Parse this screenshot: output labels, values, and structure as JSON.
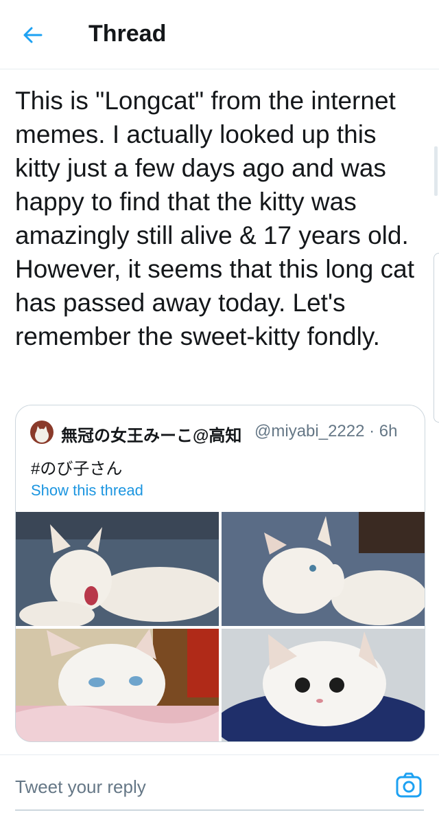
{
  "header": {
    "title": "Thread",
    "back_icon": "arrow-left-icon"
  },
  "tweet": {
    "text": "This is \"Longcat\" from the internet memes. I actually looked up this kitty just a few days ago and was happy to find that the kitty was amazingly still alive & 17 years old. However, it seems that this long cat has passed away today. Let's remember the sweet-kitty fondly."
  },
  "quoted_tweet": {
    "display_name": "無冠の女王みーこ@高知",
    "handle_time": "@miyabi_2222 · 6h",
    "text": "#のび子さん",
    "show_thread": "Show this thread",
    "photos": [
      "white-cat-yawning",
      "white-cat-licking-paw",
      "white-cat-blue-eyes-on-pink-towel",
      "white-cat-in-blue-bed"
    ]
  },
  "reply": {
    "placeholder": "Tweet your reply",
    "camera_icon": "camera-icon"
  },
  "colors": {
    "accent": "#1b95e0",
    "secondary_text": "#657786",
    "border": "#ccd6dd"
  }
}
